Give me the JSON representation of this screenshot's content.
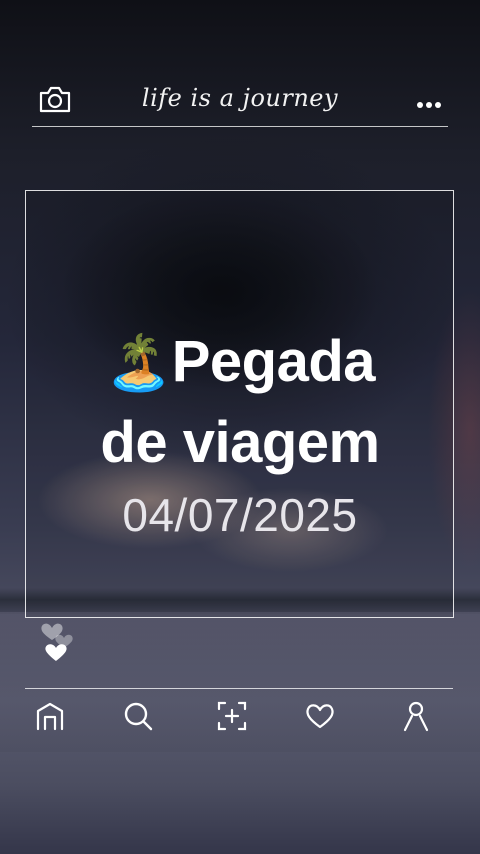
{
  "header": {
    "title": "life is a journey",
    "left_icon": "camera-icon",
    "right_icon": "more-dots-icon"
  },
  "card": {
    "emoji": "🏝️",
    "headline_line1": "Pegada",
    "headline_line2": "de viagem",
    "date": "04/07/2025"
  },
  "decor": {
    "hearts_icon": "hearts-icon"
  },
  "nav": {
    "items": [
      {
        "icon": "home-icon"
      },
      {
        "icon": "search-icon"
      },
      {
        "icon": "add-post-icon"
      },
      {
        "icon": "heart-icon"
      },
      {
        "icon": "profile-icon"
      }
    ]
  },
  "colors": {
    "line": "#ffffff",
    "text": "#ffffff",
    "date_text": "#e7e5ea",
    "sky_dark": "#0f1016",
    "sky_mid": "#3a3d52"
  }
}
